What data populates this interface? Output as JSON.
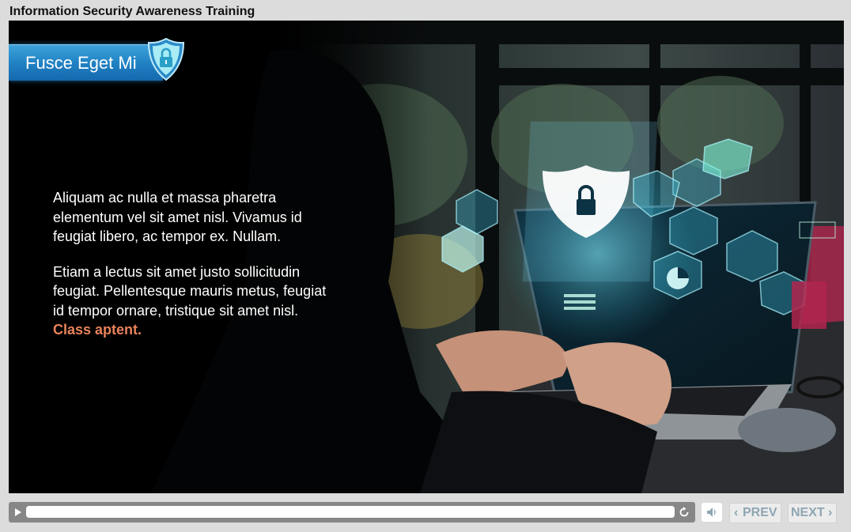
{
  "app": {
    "title": "Information Security Awareness Training"
  },
  "slide": {
    "header_title": "Fusce Eget Mi",
    "paragraphs": [
      "Aliquam ac nulla et massa pharetra elementum vel sit amet nisl. Vivamus id feugiat libero, ac tempor ex. Nullam.",
      "Etiam a lectus sit amet justo sollicitudin feugiat. Pellentesque mauris metus, feugiat id tempor ornare, tristique sit amet nisl."
    ],
    "highlight_text": "Class aptent."
  },
  "player": {
    "progress": 1.0,
    "prev_label": "PREV",
    "next_label": "NEXT",
    "prev_chevron": "‹",
    "next_chevron": "›"
  },
  "icons": {
    "badge": "shield-lock-icon",
    "play": "play-icon",
    "replay": "replay-icon",
    "volume": "speaker-icon"
  },
  "colors": {
    "accent": "#1f7fc2",
    "highlight": "#e8825a",
    "nav_text": "#8fa6b2"
  }
}
